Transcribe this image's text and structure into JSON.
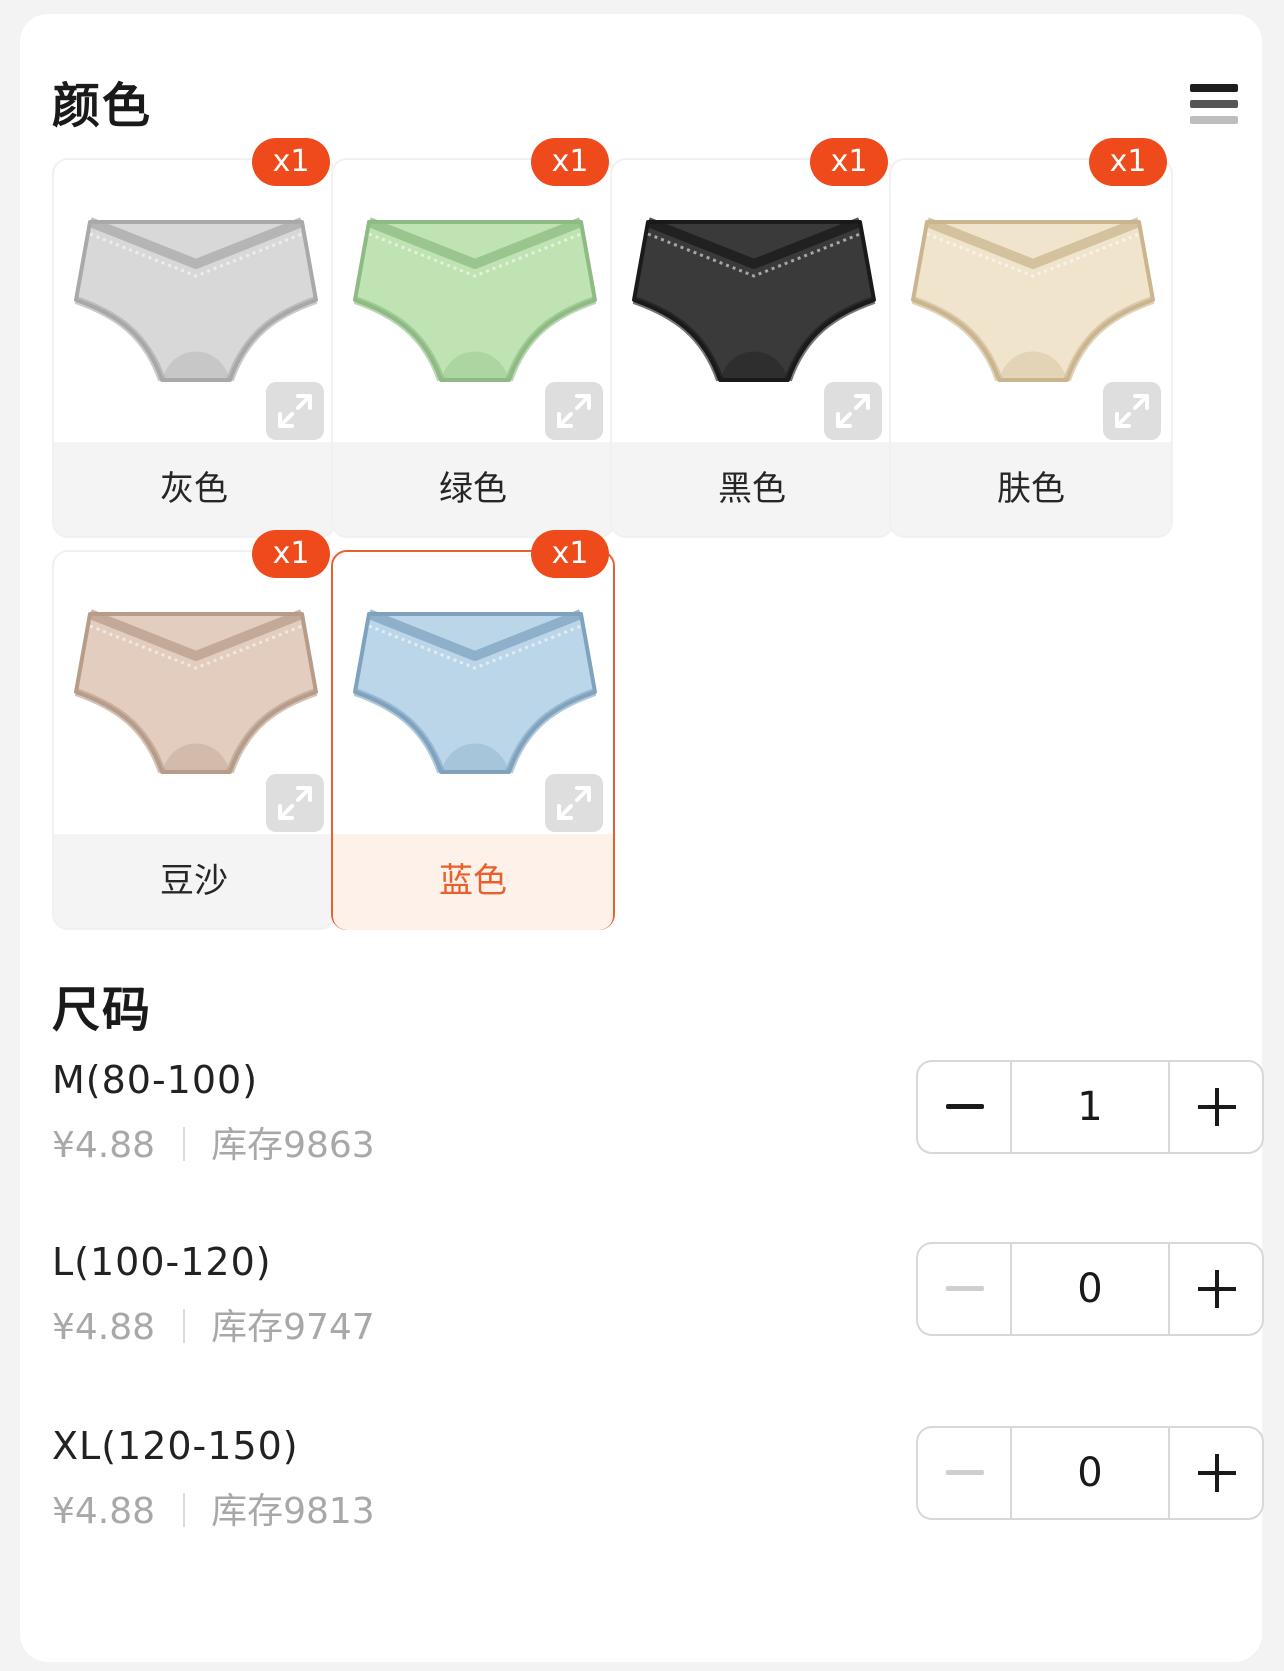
{
  "colors_section": {
    "title": "颜色",
    "items": [
      {
        "label": "灰色",
        "badge": "x1",
        "swatch": "#d8d8d8",
        "accent": "#a9a9a9",
        "selected": false
      },
      {
        "label": "绿色",
        "badge": "x1",
        "swatch": "#bfe3b2",
        "accent": "#8dbb83",
        "selected": false
      },
      {
        "label": "黑色",
        "badge": "x1",
        "swatch": "#3a3a3a",
        "accent": "#1a1a1a",
        "selected": false
      },
      {
        "label": "肤色",
        "badge": "x1",
        "swatch": "#f0e4cc",
        "accent": "#cbb58f",
        "selected": false
      },
      {
        "label": "豆沙",
        "badge": "x1",
        "swatch": "#e2cdbf",
        "accent": "#b89c8a",
        "selected": false
      },
      {
        "label": "蓝色",
        "badge": "x1",
        "swatch": "#bcd6e9",
        "accent": "#7fa3bf",
        "selected": true
      }
    ]
  },
  "size_section": {
    "title": "尺码",
    "rows": [
      {
        "name": "M(80-100)",
        "price": "¥4.88",
        "stock": "库存9863",
        "qty": "1",
        "min_disabled": false
      },
      {
        "name": "L(100-120)",
        "price": "¥4.88",
        "stock": "库存9747",
        "qty": "0",
        "min_disabled": true
      },
      {
        "name": "XL(120-150)",
        "price": "¥4.88",
        "stock": "库存9813",
        "qty": "0",
        "min_disabled": true
      }
    ]
  },
  "theme": {
    "accent": "#e8602c",
    "badge": "#ee4a1b"
  }
}
